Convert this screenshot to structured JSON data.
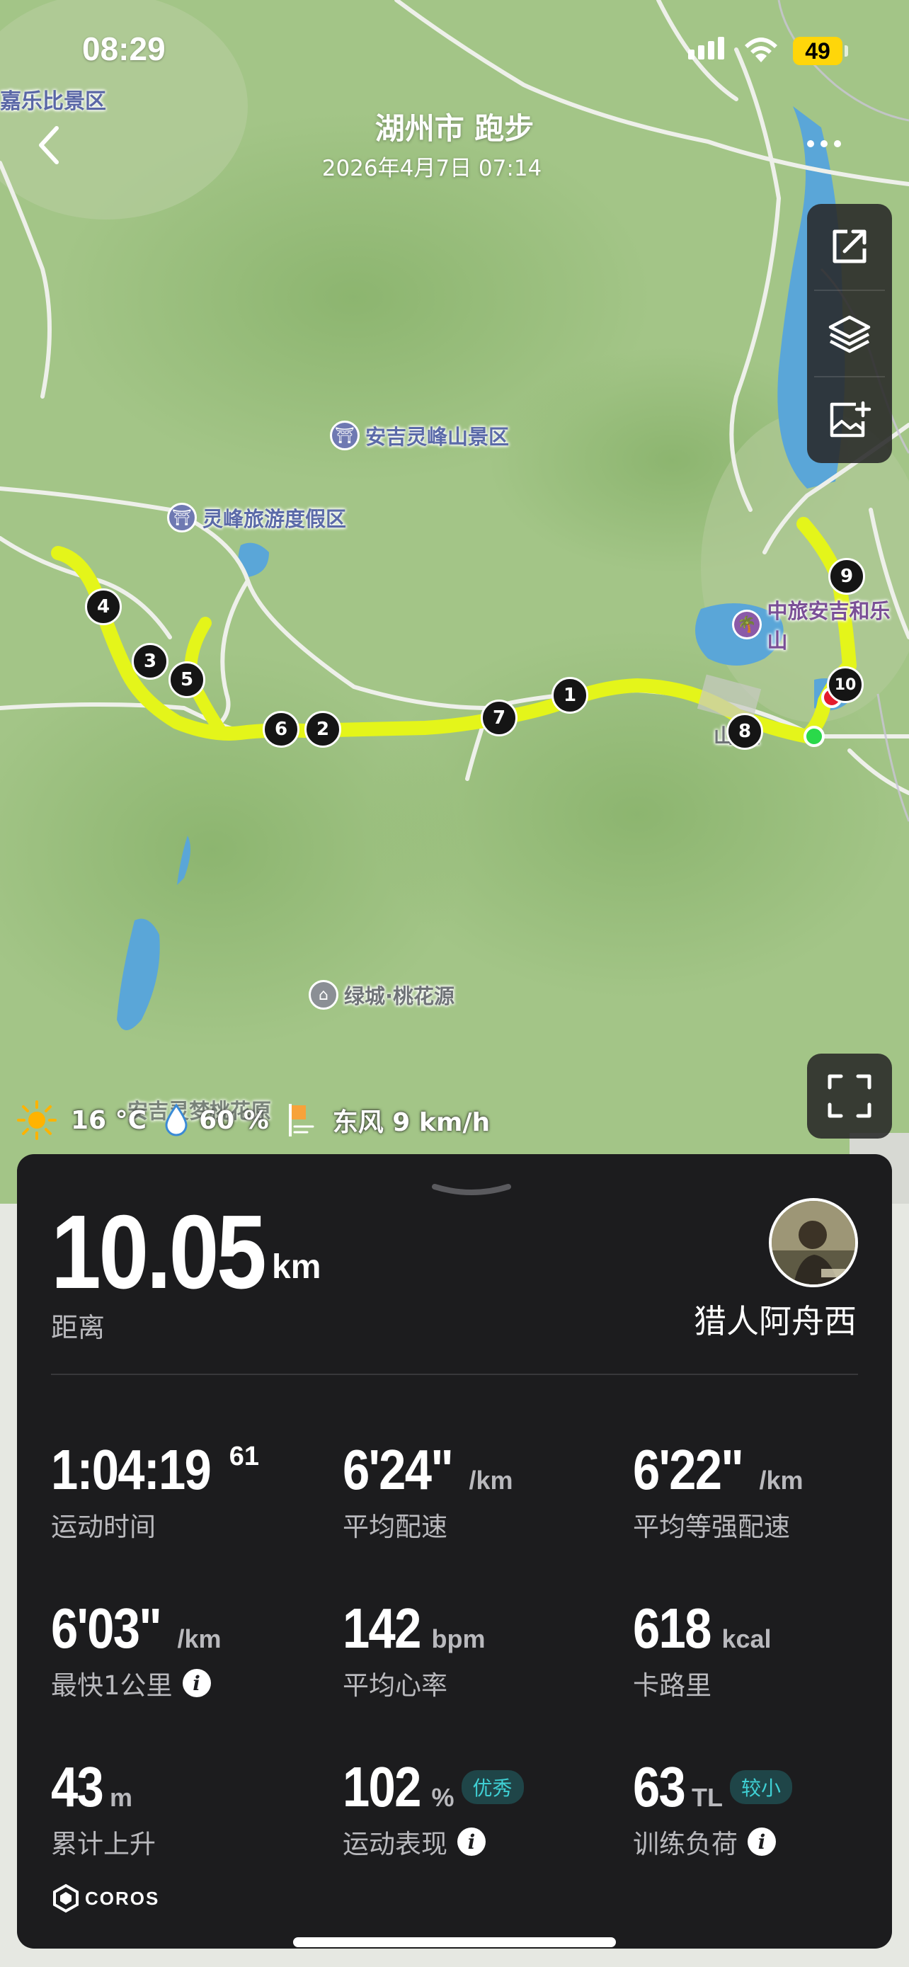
{
  "status_bar": {
    "time": "08:29",
    "battery": "49"
  },
  "header": {
    "title": "湖州市 跑步",
    "datetime": "2026年4月7日 07:14"
  },
  "map": {
    "pois": {
      "jiale": "嘉乐比景区",
      "anji_lingfeng": "安吉灵峰山景区",
      "lingfeng_resort": "灵峰旅游度假区",
      "zhonglv": "中旅安吉和乐山",
      "lvcheng": "绿城·桃花源",
      "anji_dream": "安吉灵梦桃花原",
      "shan_label": "山   里"
    },
    "km_markers": [
      "1",
      "2",
      "3",
      "4",
      "5",
      "6",
      "7",
      "8",
      "9",
      "10"
    ],
    "route_color": "#e4f51a"
  },
  "weather": {
    "temperature": "16 °C",
    "humidity": "60 %",
    "wind": "东风 9 km/h"
  },
  "summary": {
    "distance": "10.05",
    "distance_unit": "km",
    "distance_label": "距离",
    "username": "猎人阿舟西"
  },
  "stats": {
    "duration": {
      "value": "1:04:19",
      "sup": "61",
      "label": "运动时间"
    },
    "avg_pace": {
      "value": "6'24\"",
      "unit": "/km",
      "label": "平均配速"
    },
    "grade_pace": {
      "value": "6'22\"",
      "unit": "/km",
      "label": "平均等强配速"
    },
    "fastest_km": {
      "value": "6'03\"",
      "unit": "/km",
      "label": "最快1公里"
    },
    "avg_hr": {
      "value": "142",
      "unit": "bpm",
      "label": "平均心率"
    },
    "calories": {
      "value": "618",
      "unit": "kcal",
      "label": "卡路里"
    },
    "elevation": {
      "value": "43",
      "unit": "m",
      "label": "累计上升"
    },
    "performance": {
      "value": "102",
      "unit": "%",
      "badge": "优秀",
      "label": "运动表现"
    },
    "training_load": {
      "value": "63",
      "unit": "TL",
      "badge": "较小",
      "label": "训练负荷"
    }
  },
  "brand": {
    "name": "COROS"
  }
}
